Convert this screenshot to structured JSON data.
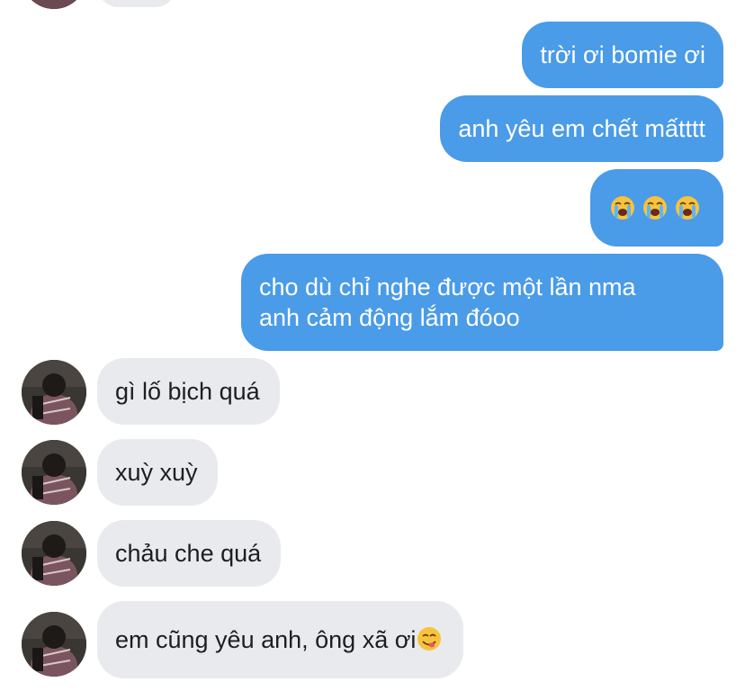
{
  "outgoing": [
    {
      "text": "trời ơi bomie ơi"
    },
    {
      "text": "anh yêu em chết mấtttt"
    },
    {
      "emojis": [
        "loudly-crying-face-icon",
        "loudly-crying-face-icon",
        "loudly-crying-face-icon"
      ]
    },
    {
      "line1": "cho dù chỉ nghe được một lần nma",
      "line2": "anh cảm động lắm đóoo"
    }
  ],
  "incoming": [
    {
      "text": "gì lố bịch quá"
    },
    {
      "text": "xuỳ xuỳ"
    },
    {
      "text": "chảu che quá"
    },
    {
      "text": "em cũng yêu anh, ông xã ơi",
      "emoji": "face-savoring-food-icon"
    }
  ],
  "colors": {
    "outgoing_bubble": "#4a9be8",
    "incoming_bubble": "#e8eaee",
    "outgoing_text": "#ffffff",
    "incoming_text": "#1c1e21"
  }
}
